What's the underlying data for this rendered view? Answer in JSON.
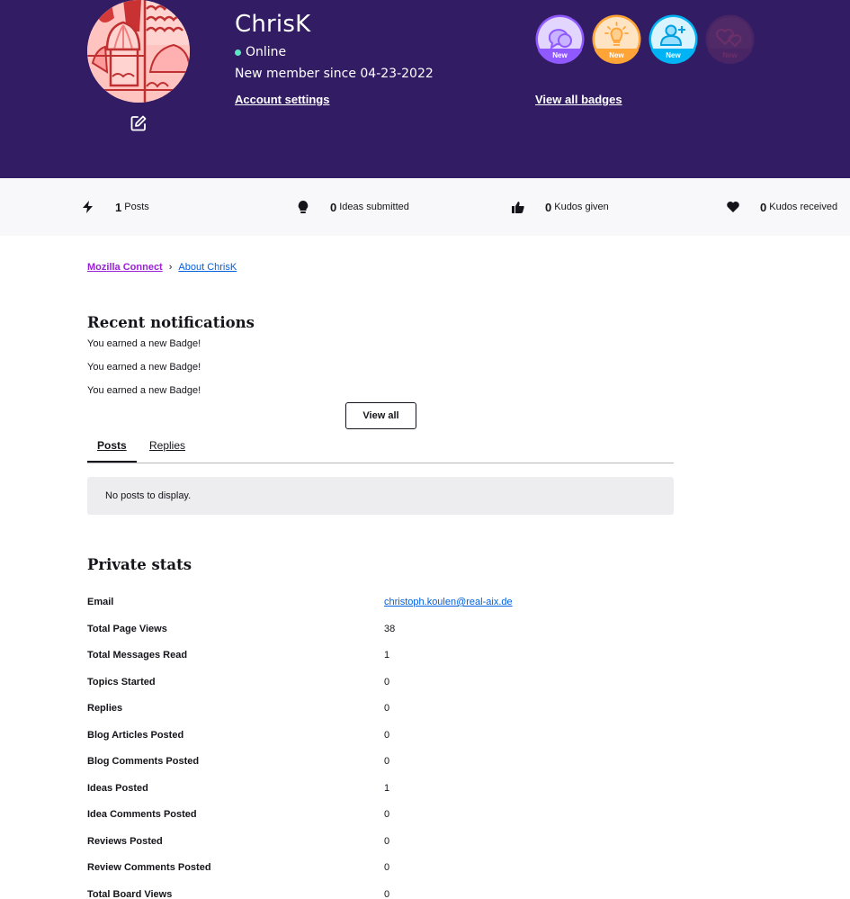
{
  "profile": {
    "username": "ChrisK",
    "status": "Online",
    "member_since": "New member since 04-23-2022",
    "account_settings_label": "Account settings",
    "view_badges_label": "View all badges",
    "badges": [
      {
        "icon": "speech-bubbles-icon",
        "label": "New",
        "color": "#9059ff",
        "bg": "#e7dcff",
        "faded": false
      },
      {
        "icon": "lightbulb-icon",
        "label": "New",
        "color": "#ffa436",
        "bg": "#ffe6c7",
        "faded": false
      },
      {
        "icon": "add-user-icon",
        "label": "New",
        "color": "#00b3f4",
        "bg": "#d9f4ff",
        "faded": false
      },
      {
        "icon": "hearts-icon",
        "label": "New",
        "color": "#6b2a69",
        "bg": "#4f2766",
        "faded": true
      }
    ]
  },
  "colors": {
    "hero_bg": "#321c64",
    "online_dot": "#5ee6c3",
    "link_blue": "#0060df",
    "breadcrumb_purple": "#9b22d6"
  },
  "stats": [
    {
      "icon": "lightning-icon",
      "value": "1",
      "label": "Posts"
    },
    {
      "icon": "lightbulb-icon",
      "value": "0",
      "label": "Ideas submitted"
    },
    {
      "icon": "thumbs-up-icon",
      "value": "0",
      "label": "Kudos given"
    },
    {
      "icon": "heart-icon",
      "value": "0",
      "label": "Kudos received"
    }
  ],
  "breadcrumb": {
    "home": "Mozilla Connect",
    "separator": "›",
    "current": "About ChrisK"
  },
  "notifications": {
    "title": "Recent notifications",
    "items": [
      "You earned a new Badge!",
      "You earned a new Badge!",
      "You earned a new Badge!"
    ],
    "view_all_label": "View all"
  },
  "tabs": {
    "items": [
      {
        "label": "Posts",
        "active": true
      },
      {
        "label": "Replies",
        "active": false
      }
    ],
    "empty_message": "No posts to display."
  },
  "private_stats": {
    "title": "Private stats",
    "rows": [
      {
        "key": "Email",
        "value": "christoph.koulen@real-aix.de",
        "link": true
      },
      {
        "key": "Total Page Views",
        "value": "38"
      },
      {
        "key": "Total Messages Read",
        "value": "1"
      },
      {
        "key": "Topics Started",
        "value": "0"
      },
      {
        "key": "Replies",
        "value": "0"
      },
      {
        "key": "Blog Articles Posted",
        "value": "0"
      },
      {
        "key": "Blog Comments Posted",
        "value": "0"
      },
      {
        "key": "Ideas Posted",
        "value": "1"
      },
      {
        "key": "Idea Comments Posted",
        "value": "0"
      },
      {
        "key": "Reviews Posted",
        "value": "0"
      },
      {
        "key": "Review Comments Posted",
        "value": "0"
      },
      {
        "key": "Total Board Views",
        "value": "0"
      }
    ]
  }
}
